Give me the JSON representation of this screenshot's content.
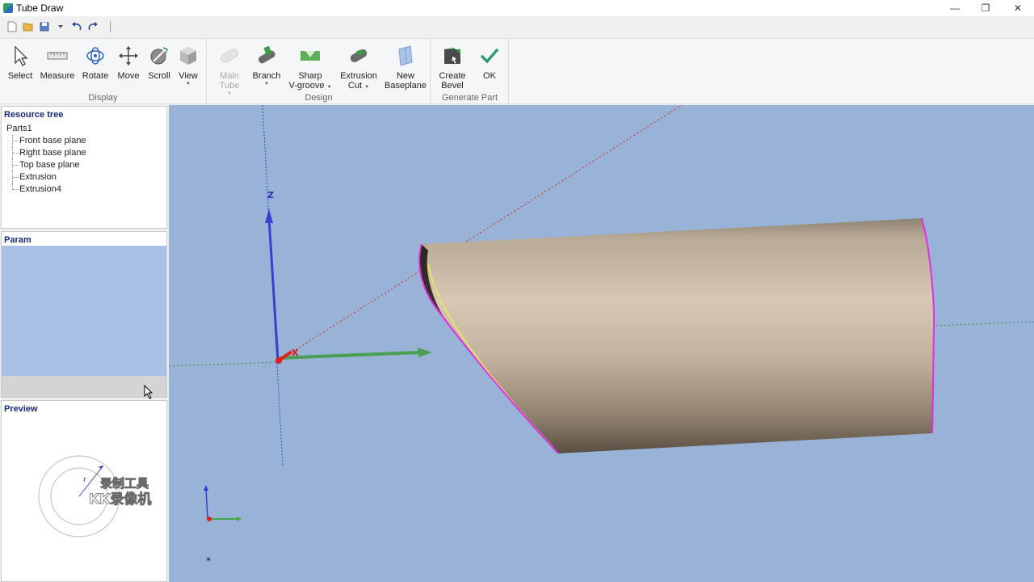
{
  "window": {
    "title": "Tube Draw",
    "minimize": "—",
    "restore": "❐",
    "close": "✕"
  },
  "qat": [
    "new-icon",
    "open-icon",
    "save-icon",
    "undo-icon",
    "redo-icon"
  ],
  "ribbon": {
    "display": {
      "label": "Display",
      "select": "Select",
      "measure": "Measure",
      "rotate": "Rotate",
      "move": "Move",
      "scroll": "Scroll",
      "view": "View"
    },
    "design": {
      "label": "Design",
      "main_tube_1": "Main",
      "main_tube_2": "Tube",
      "branch": "Branch",
      "sharp_1": "Sharp",
      "sharp_2": "V-groove",
      "extrusion_1": "Extrusion",
      "extrusion_2": "Cut",
      "baseplane_1": "New",
      "baseplane_2": "Baseplane"
    },
    "generate": {
      "label": "Generate Part",
      "bevel_1": "Create",
      "bevel_2": "Bevel",
      "ok": "OK"
    }
  },
  "resource_tree": {
    "title": "Resource tree",
    "root": "Parts1",
    "items": [
      "Front base plane",
      "Right base plane",
      "Top base plane",
      "Extrusion",
      "Extrusion4"
    ]
  },
  "param": {
    "title": "Param"
  },
  "preview": {
    "title": "Preview",
    "radius_label": "r",
    "watermark_1": "录制工具",
    "watermark_2": "KK录像机"
  },
  "viewport": {
    "z_label": "Z",
    "x_label": "X",
    "star": "*"
  },
  "colors": {
    "viewport_bg": "#99b3d6",
    "tube": "#c8b59e",
    "edge": "#e22de0",
    "axis_z": "#3a3fd0",
    "axis_y": "#49a34f",
    "axis_x": "#e02020"
  }
}
